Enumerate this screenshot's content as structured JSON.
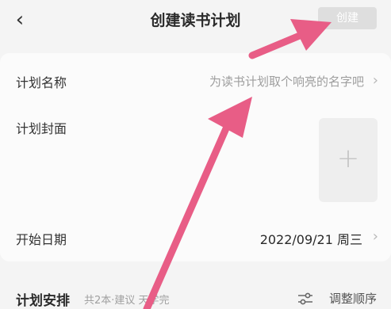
{
  "header": {
    "back_icon": "chevron-left-icon",
    "title": "创建读书计划",
    "create_label": "创建"
  },
  "form": {
    "name_label": "计划名称",
    "name_placeholder": "为读书计划取个响亮的名字吧",
    "cover_label": "计划封面",
    "cover_add_icon": "plus-icon",
    "start_date_label": "开始日期",
    "start_date_value": "2022/09/21 周三"
  },
  "schedule": {
    "title": "计划安排",
    "subtitle": "共2本·建议",
    "subtitle_tail": "天学完",
    "reorder_label": "调整顺序",
    "reorder_icon": "sliders-icon"
  },
  "colors": {
    "annotation_arrow": "#e85d86",
    "create_button_disabled": "#dedede"
  }
}
